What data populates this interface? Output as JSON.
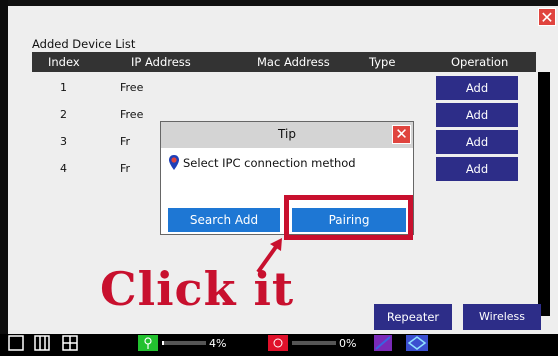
{
  "colors": {
    "accent_blue": "#1e77d4",
    "button_navy": "#2d2d88",
    "close_red": "#e0443e",
    "annotation_red": "#c8102e"
  },
  "device_list": {
    "title": "Added Device List",
    "columns": [
      "Index",
      "IP Address",
      "Mac Address",
      "Type",
      "Operation"
    ],
    "rows": [
      {
        "index": "1",
        "ip": "Free",
        "action": "Add"
      },
      {
        "index": "2",
        "ip": "Free",
        "action": "Add"
      },
      {
        "index": "3",
        "ip": "Fr",
        "action": "Add"
      },
      {
        "index": "4",
        "ip": "Fr",
        "action": "Add"
      }
    ]
  },
  "tip_dialog": {
    "title": "Tip",
    "message": "Select IPC connection method",
    "search_add": "Search Add",
    "pairing": "Pairing"
  },
  "annotation": {
    "text": "Click it"
  },
  "bottom_buttons": {
    "repeater": "Repeater",
    "wireless_status": "Wireless status"
  },
  "taskbar": {
    "signal_1_percent": "4%",
    "signal_2_percent": "0%",
    "signal_1_level": 0.04,
    "signal_2_level": 0.0,
    "icons": [
      "single-view-icon",
      "quad-split-icon",
      "grid-view-icon",
      "camera-signal-icon",
      "record-icon",
      "network-icon",
      "wifi-icon"
    ]
  }
}
